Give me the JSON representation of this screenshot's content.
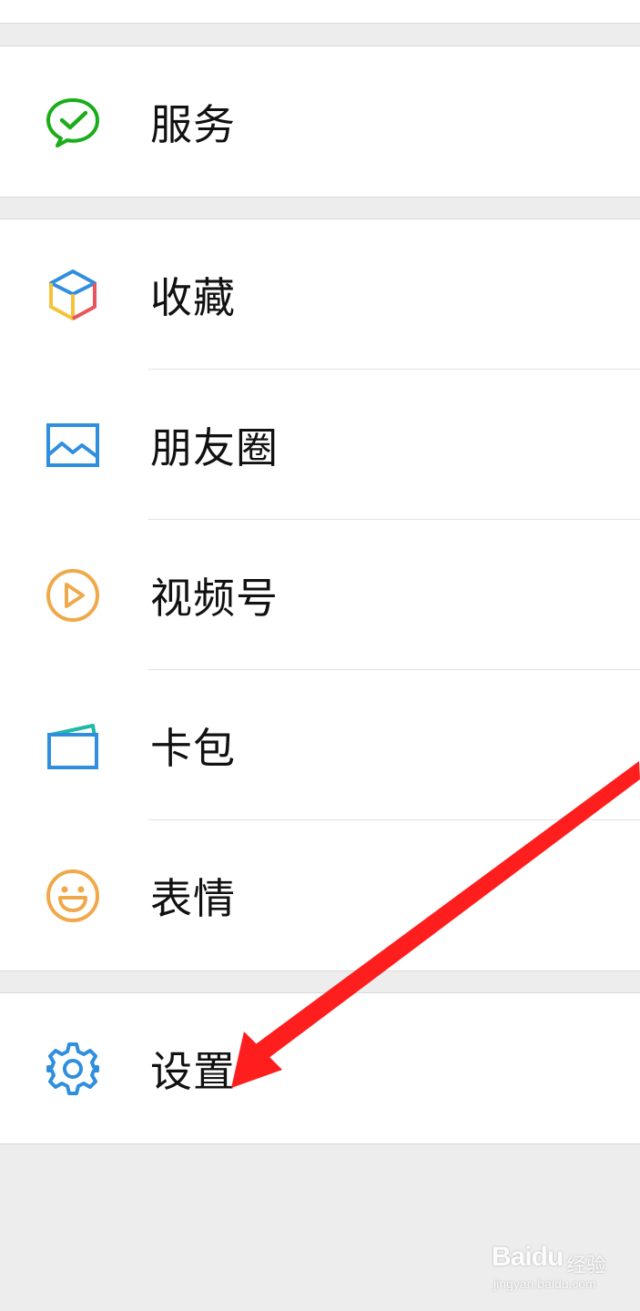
{
  "menu": {
    "services": {
      "label": "服务",
      "icon": "wechat-pay-icon",
      "color": "#1aad19"
    },
    "items": [
      {
        "label": "收藏",
        "icon": "favorites-cube-icon"
      },
      {
        "label": "朋友圈",
        "icon": "moments-picture-icon",
        "color": "#2f8fde"
      },
      {
        "label": "视频号",
        "icon": "channels-play-icon",
        "color": "#f0a94a"
      },
      {
        "label": "卡包",
        "icon": "card-wallet-icon",
        "color": "#2f8fde"
      },
      {
        "label": "表情",
        "icon": "sticker-smiley-icon",
        "color": "#f0a94a"
      }
    ],
    "settings": {
      "label": "设置",
      "icon": "gear-icon",
      "color": "#2f8fde"
    }
  },
  "annotation": {
    "arrow_color": "#ff1e1e"
  },
  "watermark": {
    "brand": "Baidu",
    "service": "经验",
    "url": "jingyan.baidu.com"
  }
}
